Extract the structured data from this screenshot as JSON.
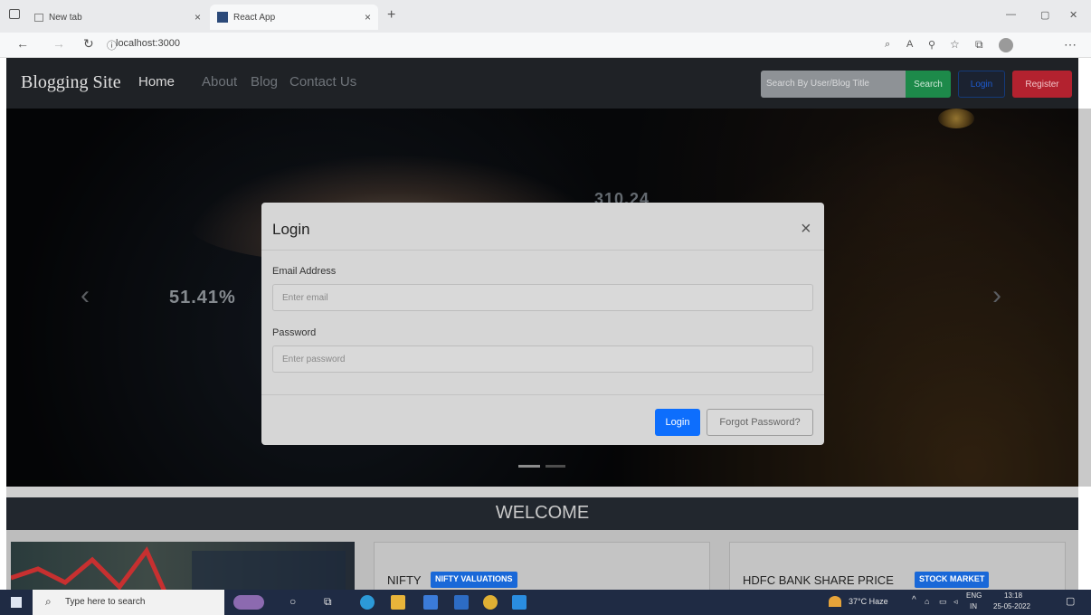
{
  "browser": {
    "tabs": [
      {
        "label": "New tab"
      },
      {
        "label": "React App"
      }
    ],
    "new_tab": "+",
    "url": "localhost:3000",
    "window_controls": [
      "—",
      "▢",
      "✕"
    ]
  },
  "navbar": {
    "brand": "Blogging Site",
    "links": [
      "Home",
      "About",
      "Blog",
      "Contact Us"
    ],
    "search_placeholder": "Search By User/Blog Title",
    "search_button": "Search",
    "login_button": "Login",
    "register_button": "Register"
  },
  "hero": {
    "stat_left": "51.41%",
    "stat_top": "310.24",
    "prev_icon": "‹",
    "next_icon": "›"
  },
  "modal": {
    "title": "Login",
    "close": "×",
    "email_label": "Email Address",
    "email_placeholder": "Enter email",
    "password_label": "Password",
    "password_placeholder": "Enter password",
    "login_button": "Login",
    "forgot_button": "Forgot Password?"
  },
  "welcome": "WELCOME",
  "cards": [
    {
      "title": "NIFTY",
      "badge": "NIFTY VALUATIONS"
    },
    {
      "title": "HDFC BANK SHARE PRICE",
      "badge": "STOCK MARKET"
    }
  ],
  "taskbar": {
    "search_placeholder": "Type here to search",
    "weather": "37°C Haze",
    "lang": "ENG",
    "region": "IN",
    "time": "13:18",
    "date": "25-05-2022"
  }
}
